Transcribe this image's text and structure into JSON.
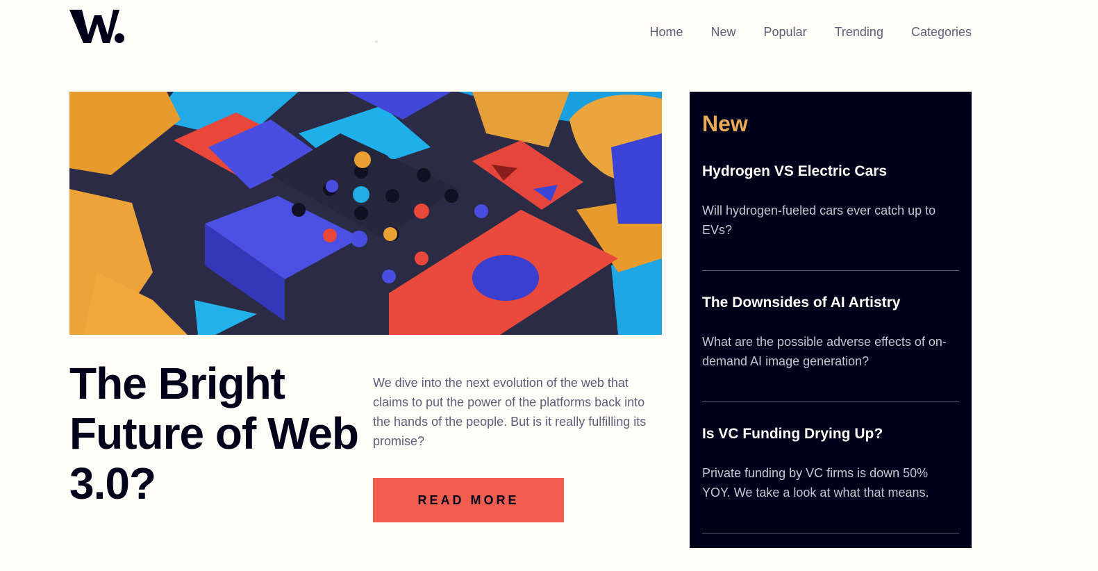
{
  "brand": {
    "logo_text": "W."
  },
  "nav": {
    "items": [
      "Home",
      "New",
      "Popular",
      "Trending",
      "Categories"
    ]
  },
  "hero": {
    "image_icon": "abstract-blocks-image",
    "headline": "The Bright Future of Web 3.0?",
    "lead": "We dive into the next evolution of the web that claims to put the power of the platforms back into the hands of the people. But is it really fulfilling its promise?",
    "cta_label": "READ MORE"
  },
  "sidebar": {
    "title": "New",
    "posts": [
      {
        "title": "Hydrogen VS Electric Cars",
        "summary": "Will hydrogen-fueled cars ever catch up to EVs?"
      },
      {
        "title": "The Downsides of AI Artistry",
        "summary": "What are the possible adverse effects of on-demand AI image generation?"
      },
      {
        "title": "Is VC Funding Drying Up?",
        "summary": "Private funding by VC firms is down 50% YOY. We take a look at what that means."
      }
    ]
  },
  "colors": {
    "background": "#fffdf8",
    "dark": "#00001a",
    "accent_orange": "#e9ab53",
    "accent_red": "#f15e50",
    "muted": "#5d5f79"
  }
}
